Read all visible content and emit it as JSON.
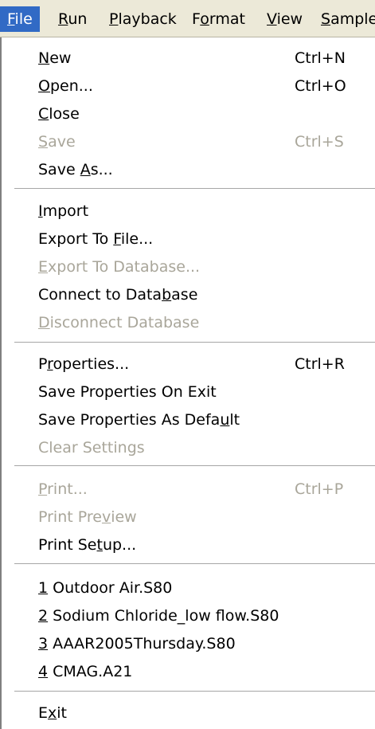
{
  "menubar": {
    "items": [
      {
        "pre": "",
        "u": "F",
        "post": "ile"
      },
      {
        "pre": "",
        "u": "R",
        "post": "un"
      },
      {
        "pre": "",
        "u": "P",
        "post": "layback"
      },
      {
        "pre": "F",
        "u": "o",
        "post": "rmat"
      },
      {
        "pre": "",
        "u": "V",
        "post": "iew"
      },
      {
        "pre": "",
        "u": "S",
        "post": "ample"
      }
    ]
  },
  "file_menu": {
    "new": {
      "pre": "",
      "u": "N",
      "post": "ew",
      "shortcut": "Ctrl+N"
    },
    "open": {
      "pre": "",
      "u": "O",
      "post": "pen...",
      "shortcut": "Ctrl+O"
    },
    "close": {
      "pre": "",
      "u": "C",
      "post": "lose"
    },
    "save": {
      "pre": "",
      "u": "S",
      "post": "ave",
      "shortcut": "Ctrl+S"
    },
    "save_as": {
      "pre": "Save ",
      "u": "A",
      "post": "s..."
    },
    "import": {
      "pre": "",
      "u": "I",
      "post": "mport"
    },
    "export_file": {
      "pre": "Export To ",
      "u": "F",
      "post": "ile..."
    },
    "export_db": {
      "pre": "",
      "u": "E",
      "post": "xport To Database..."
    },
    "connect_db": {
      "pre": "Connect to Data",
      "u": "b",
      "post": "ase"
    },
    "disconnect_db": {
      "pre": "",
      "u": "D",
      "post": "isconnect Database"
    },
    "properties": {
      "pre": "P",
      "u": "r",
      "post": "operties...",
      "shortcut": "Ctrl+R"
    },
    "save_props_exit": {
      "label": "Save Properties On Exit"
    },
    "save_props_default": {
      "pre": "Save Properties As Defa",
      "u": "u",
      "post": "lt"
    },
    "clear_settings": {
      "label": "Clear Settings"
    },
    "print": {
      "pre": "",
      "u": "P",
      "post": "rint...",
      "shortcut": "Ctrl+P"
    },
    "print_preview": {
      "pre": "Print Pre",
      "u": "v",
      "post": "iew"
    },
    "print_setup": {
      "pre": "Print Se",
      "u": "t",
      "post": "up..."
    },
    "recent": [
      {
        "u": "1",
        "post": " Outdoor Air.S80"
      },
      {
        "u": "2",
        "post": " Sodium Chloride_low flow.S80"
      },
      {
        "u": "3",
        "post": " AAAR2005Thursday.S80"
      },
      {
        "u": "4",
        "post": " CMAG.A21"
      }
    ],
    "exit": {
      "pre": "E",
      "u": "x",
      "post": "it"
    }
  }
}
